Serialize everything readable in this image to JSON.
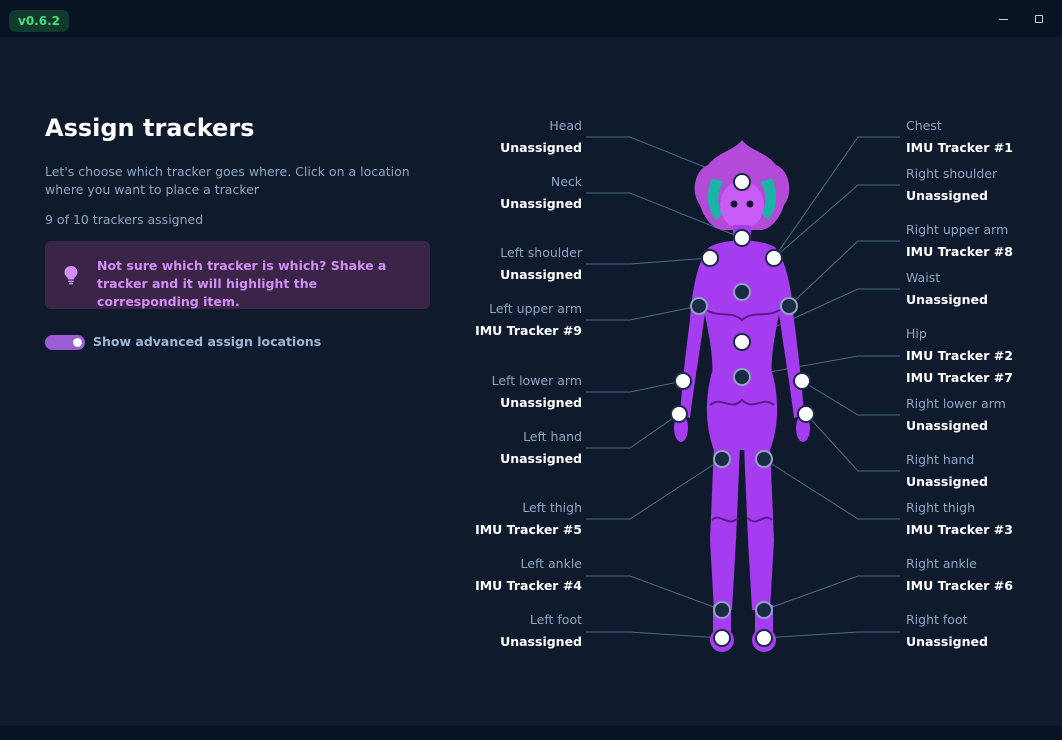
{
  "app": {
    "version": "v0.6.2"
  },
  "page": {
    "title": "Assign trackers",
    "description": "Let's choose which tracker goes where. Click on a location where you want to place a tracker",
    "count": "9 of 10 trackers assigned",
    "tip": "Not sure which tracker is which? Shake a tracker and it will highlight the corresponding item.",
    "toggle_label": "Show advanced assign locations",
    "toggle_on": true
  },
  "locations": {
    "head": {
      "name": "Head",
      "value": "Unassigned"
    },
    "neck": {
      "name": "Neck",
      "value": "Unassigned"
    },
    "left_shoulder": {
      "name": "Left shoulder",
      "value": "Unassigned"
    },
    "left_upper_arm": {
      "name": "Left upper arm",
      "value": "IMU Tracker #9"
    },
    "left_lower_arm": {
      "name": "Left lower arm",
      "value": "Unassigned"
    },
    "left_hand": {
      "name": "Left hand",
      "value": "Unassigned"
    },
    "left_thigh": {
      "name": "Left thigh",
      "value": "IMU Tracker #5"
    },
    "left_ankle": {
      "name": "Left ankle",
      "value": "IMU Tracker #4"
    },
    "left_foot": {
      "name": "Left foot",
      "value": "Unassigned"
    },
    "chest": {
      "name": "Chest",
      "value": "IMU Tracker #1"
    },
    "right_shoulder": {
      "name": "Right shoulder",
      "value": "Unassigned"
    },
    "right_upper_arm": {
      "name": "Right upper arm",
      "value": "IMU Tracker #8"
    },
    "waist": {
      "name": "Waist",
      "value": "Unassigned"
    },
    "hip": {
      "name": "Hip",
      "value": "IMU Tracker #2",
      "value2": "IMU Tracker #7"
    },
    "right_lower_arm": {
      "name": "Right lower arm",
      "value": "Unassigned"
    },
    "right_hand": {
      "name": "Right hand",
      "value": "Unassigned"
    },
    "right_thigh": {
      "name": "Right thigh",
      "value": "IMU Tracker #3"
    },
    "right_ankle": {
      "name": "Right ankle",
      "value": "IMU Tracker #6"
    },
    "right_foot": {
      "name": "Right foot",
      "value": "Unassigned"
    }
  },
  "icons": {
    "tip": "lightbulb-icon",
    "minimize": "minimize-icon",
    "maximize": "maximize-icon"
  },
  "colors": {
    "background": "#0f1b2d",
    "titlebar": "#081423",
    "version_text": "#4ade80",
    "tip_bg": "#3a2448",
    "tip_text": "#d28ef5",
    "accent": "#9b5cd6",
    "body_fill": "#a53cf0",
    "dot_unassigned": "#ffffff",
    "dot_assigned": "#1b2a45"
  }
}
